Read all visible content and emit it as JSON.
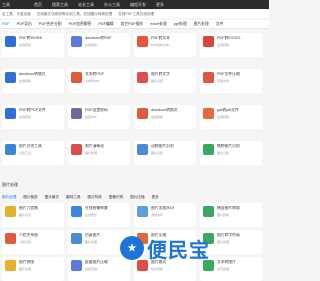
{
  "header": {
    "logo": "工具",
    "nav": [
      "首页",
      "搜索工具",
      "站长工具",
      "办公工具",
      "编程开发",
      "更多"
    ]
  },
  "notice": {
    "left": "全工具，丰富全面",
    "middle": "在线格式化修改等实用工具，在线图片转换处理",
    "right": "在线PDF工具在线处理"
  },
  "tabs": [
    {
      "label": "PDF",
      "active": true
    },
    {
      "label": "PDF导出"
    },
    {
      "label": "PDF合并分割"
    },
    {
      "label": "PDF加密解密"
    },
    {
      "label": "PDF编辑"
    },
    {
      "label": "其它PDF操作"
    },
    {
      "label": "excel处理"
    },
    {
      "label": "ppt处理"
    },
    {
      "label": "图片处理"
    },
    {
      "label": "文件"
    }
  ],
  "cards_row1": [
    {
      "title": "PDF转WORD",
      "desc": "在线转换",
      "color": "#2f6fd6"
    },
    {
      "title": "doc/docx转PDF",
      "desc": "在线转换",
      "color": "#5a7be0"
    },
    {
      "title": "PDF转文本",
      "desc": "PDF转换文本",
      "color": "#e8553b"
    },
    {
      "title": "PDF转EXCEL",
      "desc": "在线转换",
      "color": "#d9463a"
    }
  ],
  "cards_row2": [
    {
      "title": "doc/docx转格式",
      "desc": "在线转换",
      "color": "#2f6fd6"
    },
    {
      "title": "文本转PDF",
      "desc": "文本转PDF",
      "color": "#e05a3c"
    },
    {
      "title": "图片转文字",
      "desc": "图片识别",
      "color": "#e04c4c"
    },
    {
      "title": "PDF文件压缩",
      "desc": "压缩文件",
      "color": "#e0553f"
    }
  ],
  "cards_row3": [
    {
      "title": "PDF转PDF文件",
      "desc": "在线转换",
      "color": "#2f6fd6"
    },
    {
      "title": "PDF设置密码",
      "desc": "加密PDF",
      "color": "#6c6c9c"
    },
    {
      "title": "doc/docx转换文",
      "desc": "在线转换",
      "color": "#e05a3c"
    },
    {
      "title": "ppt转pdf文件",
      "desc": "在线转换",
      "color": "#e06a3c"
    }
  ],
  "cards_row4": [
    {
      "title": "图片识别工具",
      "desc": "识别工具",
      "color": "#3a86d8"
    },
    {
      "title": "图片清晰化",
      "desc": "图片处理",
      "color": "#e04c4c"
    },
    {
      "title": "动物图片识别",
      "desc": "图片识别",
      "color": "#4a8ad8"
    },
    {
      "title": "植物图片识别",
      "desc": "图片识别",
      "color": "#3aa863"
    }
  ],
  "section_title": "图片处理",
  "subtabs": [
    {
      "label": "图片处理",
      "active": true
    },
    {
      "label": "图片裁剪"
    },
    {
      "label": "图片格式"
    },
    {
      "label": "趣味工具"
    },
    {
      "label": "图片特效"
    },
    {
      "label": "图像识别"
    },
    {
      "label": "图片压缩"
    },
    {
      "label": "更多"
    }
  ],
  "cards_row5": [
    {
      "title": "图片九宫格",
      "desc": "图片切割",
      "color": "#e6b12a"
    },
    {
      "title": "在线图像修复",
      "desc": "在线修复",
      "color": "#3a86d8"
    },
    {
      "title": "图片添加水印",
      "desc": "添加水印",
      "color": "#5a9ee0"
    },
    {
      "title": "横竖图片转换",
      "desc": "图片转换",
      "color": "#3aa863"
    }
  ],
  "cards_row6": [
    {
      "title": "人脸关系图",
      "desc": "人脸识别",
      "color": "#e05a3c"
    },
    {
      "title": "仿真图片",
      "desc": "图片处理",
      "color": "#4a8ad8"
    },
    {
      "title": "图片压缩",
      "desc": "压缩处理",
      "color": "#e06a3c"
    },
    {
      "title": "图片转字符画",
      "desc": "图片处理",
      "color": "#3aa863"
    }
  ],
  "cards_row7": [
    {
      "title": "图片拼图",
      "desc": "图片处理",
      "color": "#e6b12a"
    },
    {
      "title": "批量图片压缩",
      "desc": "批量压缩",
      "color": "#5a7be0"
    },
    {
      "title": "图片格式",
      "desc": "格式转换",
      "color": "#e04c4c"
    },
    {
      "title": "文本转图片",
      "desc": "文字处理",
      "color": "#3aa863"
    }
  ],
  "watermark": {
    "symbol": "★",
    "text": "便民宝"
  }
}
